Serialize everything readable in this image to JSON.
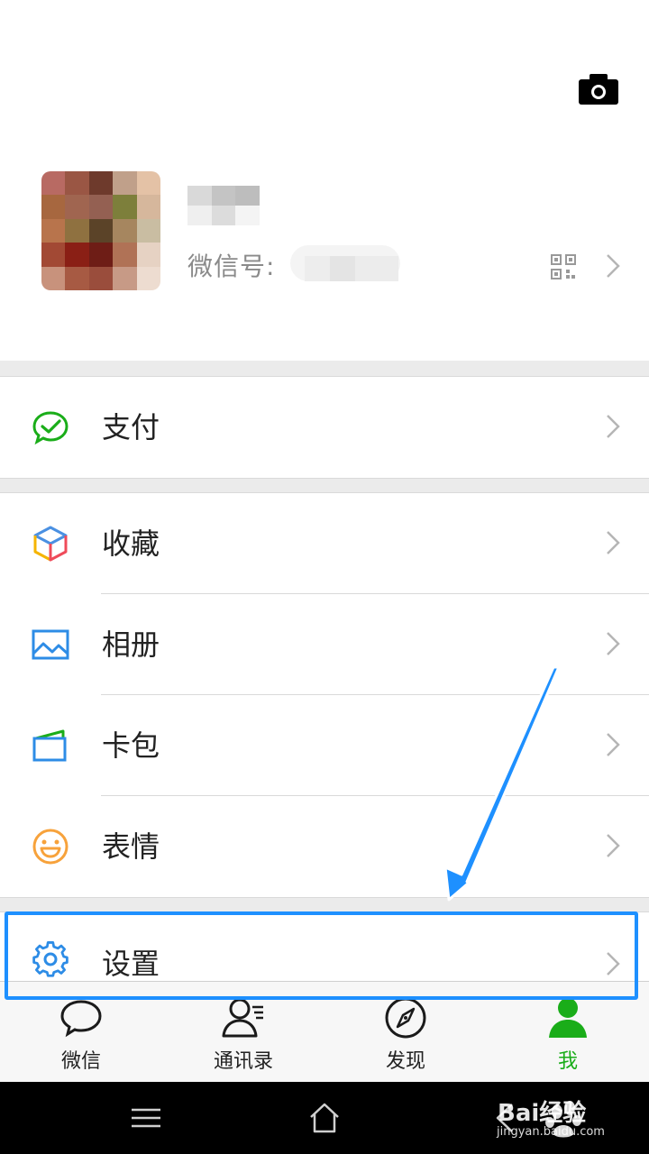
{
  "profile": {
    "wxid_label": "微信号:"
  },
  "menu": {
    "pay": {
      "label": "支付",
      "icon": "wechat-pay-icon"
    },
    "favorites": {
      "label": "收藏",
      "icon": "favorites-cube-icon"
    },
    "album": {
      "label": "相册",
      "icon": "album-picture-icon"
    },
    "cards": {
      "label": "卡包",
      "icon": "card-wallet-icon"
    },
    "stickers": {
      "label": "表情",
      "icon": "smiley-face-icon"
    },
    "settings": {
      "label": "设置",
      "icon": "gear-icon"
    }
  },
  "tabs": [
    {
      "label": "微信",
      "icon": "chat-bubble-icon",
      "active": false
    },
    {
      "label": "通讯录",
      "icon": "contacts-icon",
      "active": false
    },
    {
      "label": "发现",
      "icon": "compass-icon",
      "active": false
    },
    {
      "label": "我",
      "icon": "person-icon",
      "active": true
    }
  ],
  "watermark": {
    "brand": "Bai经验",
    "url": "jingyan.baidu.com"
  },
  "colors": {
    "accent_green": "#1aad19",
    "highlight_blue": "#1e90ff",
    "background": "#ebebeb"
  }
}
